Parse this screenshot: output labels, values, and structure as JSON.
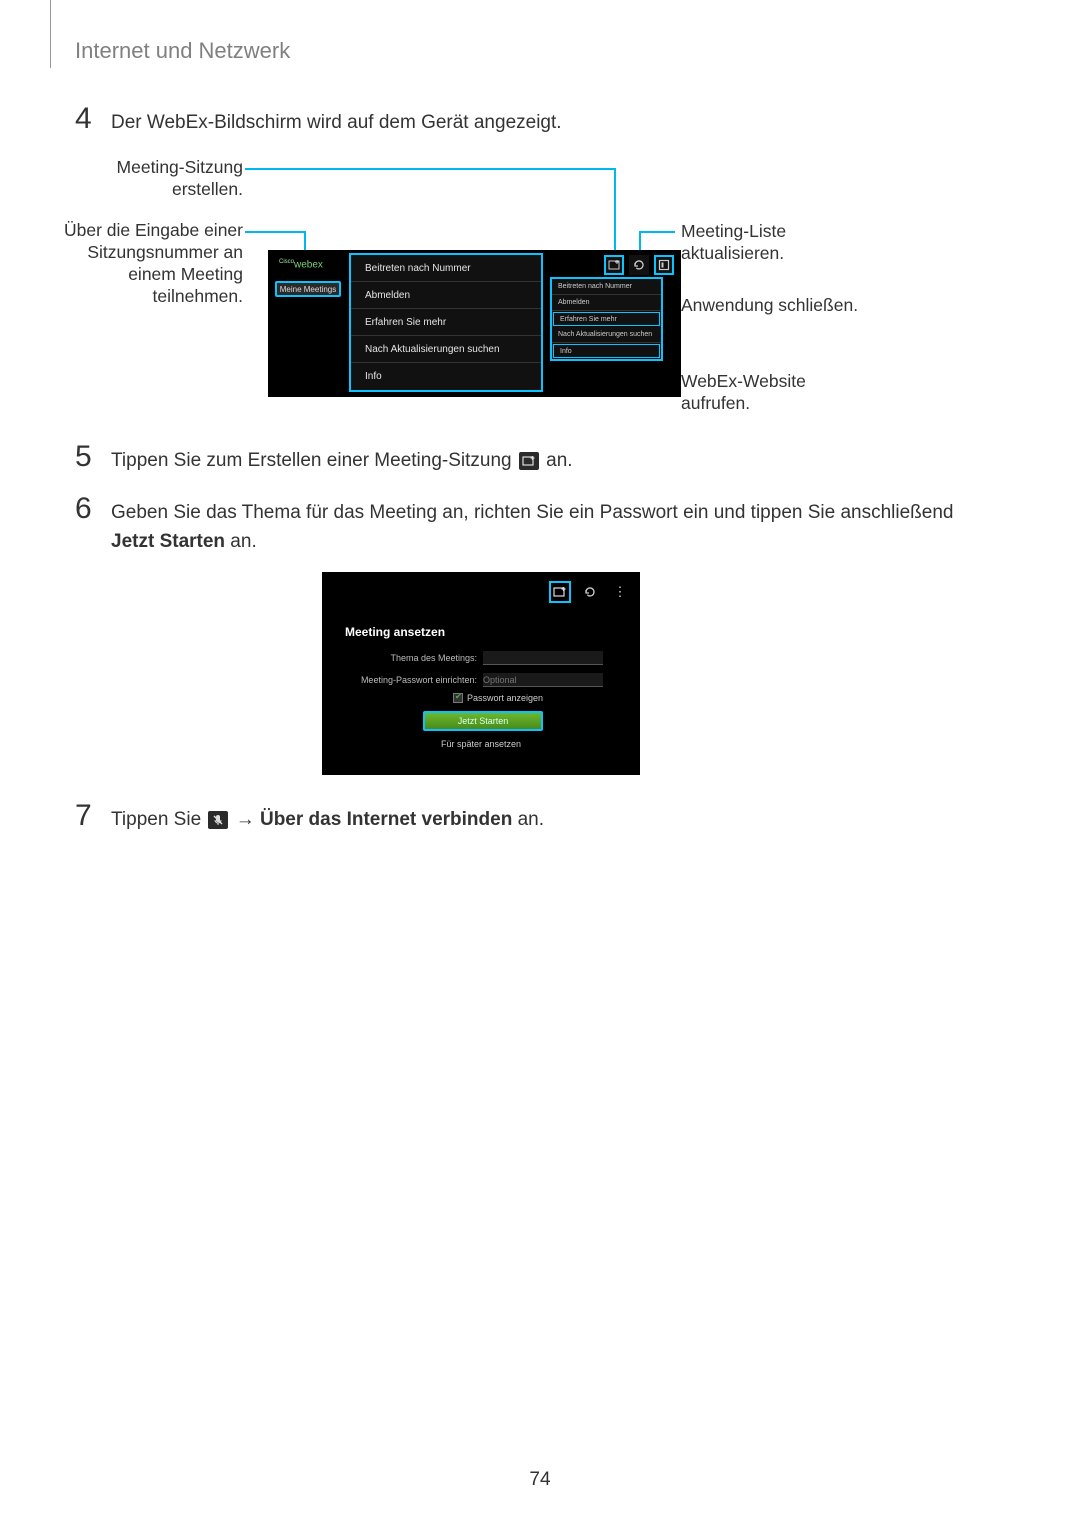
{
  "section_title": "Internet und Netzwerk",
  "page_number": "74",
  "steps": {
    "s4": {
      "num": "4",
      "text": "Der WebEx-Bildschirm wird auf dem Gerät angezeigt."
    },
    "s5": {
      "num": "5",
      "pre": "Tippen Sie zum Erstellen einer Meeting-Sitzung ",
      "post": " an."
    },
    "s6": {
      "num": "6",
      "text_a": "Geben Sie das Thema für das Meeting an, richten Sie ein Passwort ein und tippen Sie anschließend ",
      "bold": "Jetzt Starten",
      "text_b": " an."
    },
    "s7": {
      "num": "7",
      "pre": "Tippen Sie ",
      "arrow": " → ",
      "bold": "Über das Internet verbinden",
      "post": " an."
    }
  },
  "fig1": {
    "labels": {
      "create": "Meeting-Sitzung erstellen.",
      "join": "Über die Eingabe einer Sitzungsnummer an einem Meeting teilnehmen.",
      "refresh": "Meeting-Liste aktualisieren.",
      "close": "Anwendung schließen.",
      "website": "WebEx-Website aufrufen."
    },
    "webex_brand": "webex",
    "tab": "Meine Meetings",
    "menu": [
      "Beitreten nach Nummer",
      "Abmelden",
      "Erfahren Sie mehr",
      "Nach Aktualisierungen suchen",
      "Info"
    ],
    "mini": [
      "Beitreten nach Nummer",
      "Abmelden",
      "Erfahren Sie mehr",
      "Nach Aktualisierungen suchen",
      "Info"
    ]
  },
  "fig2": {
    "heading": "Meeting ansetzen",
    "theme_label": "Thema des Meetings:",
    "pass_label": "Meeting-Passwort einrichten:",
    "pass_placeholder": "Optional",
    "show_pass": "Passwort anzeigen",
    "start": "Jetzt Starten",
    "later": "Für später ansetzen"
  },
  "icons": {
    "add_plus": "⊕",
    "refresh": "↻",
    "more": "⋮",
    "info_box": "i",
    "mic_mute": "✕"
  }
}
